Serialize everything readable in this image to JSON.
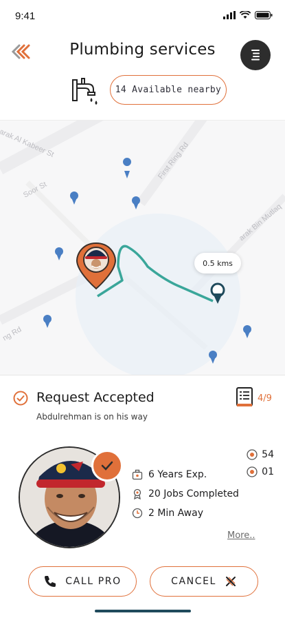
{
  "status": {
    "time": "9:41"
  },
  "header": {
    "title": "Plumbing services"
  },
  "nearby": {
    "label": "14 Available nearby"
  },
  "map": {
    "streets": [
      "arak Al Kabeer St",
      "Soor St",
      "First Ring Rd",
      "arak Bin Mutlaq",
      "ng Rd"
    ],
    "distance_label": "0.5 kms"
  },
  "request": {
    "title": "Request Accepted",
    "subtitle": "Abdulrehman is on his way",
    "step": "4/9"
  },
  "pro": {
    "stats": [
      {
        "icon": "briefcase-icon",
        "label": "6 Years Exp."
      },
      {
        "icon": "jobs-icon",
        "label": "20 Jobs Completed"
      },
      {
        "icon": "clock-icon",
        "label": "2 Min Away"
      }
    ],
    "counts": [
      {
        "icon": "like-icon",
        "value": "54"
      },
      {
        "icon": "dislike-icon",
        "value": "01"
      }
    ],
    "more_label": "More.."
  },
  "actions": {
    "call_label": "CALL PRO",
    "cancel_label": "CANCEL"
  },
  "colors": {
    "accent": "#e0703a",
    "route": "#3aa69a",
    "pin": "#4a7fc4",
    "dark": "#2d2d2d"
  }
}
